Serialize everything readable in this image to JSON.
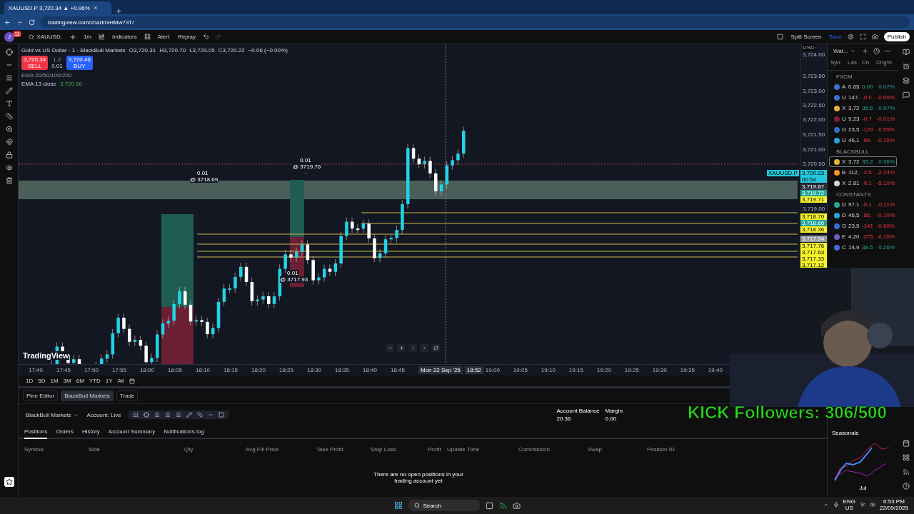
{
  "browser": {
    "tab_title": "XAUUSD.P 3,720.34 ▲ +0.96%",
    "url": "tradingview.com/chart/rxHMw73T/"
  },
  "toolbar": {
    "avatar": "J",
    "badge": "11",
    "symbol": "XAUUSD.",
    "interval": "1m",
    "indicators": "Indicators",
    "alert": "Alert",
    "replay": "Replay",
    "split_screen": "Split Screen",
    "save": "Save",
    "publish": "Publish"
  },
  "legend": {
    "title": "Gold vs US Dollar · 1 · BlackBull Markets",
    "ohlc": [
      {
        "key": "O",
        "value": "3,720.31"
      },
      {
        "key": "H",
        "value": "3,720.70"
      },
      {
        "key": "L",
        "value": "3,720.05"
      },
      {
        "key": "C",
        "value": "3,720.22"
      }
    ],
    "change": "−0.06 (−0.00%)",
    "sell_price": "3,720.34",
    "sell": "SELL",
    "spread": "1.2",
    "qty": "0.01",
    "buy_price": "3,720.46",
    "buy": "BUY",
    "ema_group": "EMA 20/50/100/200",
    "ema_label": "EMA 13 close",
    "ema_value": "3,720.50"
  },
  "trade_marks": [
    {
      "qty": "0.01",
      "price": "@ 3718.69",
      "buy": false
    },
    {
      "qty": "0.01",
      "price": "@ 3719.76",
      "buy": false
    },
    {
      "qty": "0.01",
      "price": "@ 3717.93",
      "buy": true
    }
  ],
  "price_axis": {
    "currency": "USD",
    "ticks": [
      "3,724.00",
      "3,723.50",
      "3,723.00",
      "3,722.50",
      "3,722.00",
      "3,721.50",
      "3,721.00",
      "3,720.50",
      "3,719.00"
    ],
    "tags": [
      {
        "text": "3,720.23",
        "sub": "00:54",
        "color": "#26c6da"
      },
      {
        "text": "3,719.87",
        "color": "#2a2e39"
      },
      {
        "text": "3,719.72",
        "color": "#26a69a"
      },
      {
        "text": "3,719.71",
        "color": "#f5f12b"
      },
      {
        "text": "3,718.70",
        "color": "#f5f12b"
      },
      {
        "text": "3,718.66",
        "color": "#26a69a"
      },
      {
        "text": "3,718.36",
        "color": "#f5f12b"
      },
      {
        "text": "3,717.94",
        "color": "#9598a1"
      },
      {
        "text": "3,717.76",
        "color": "#f5f12b"
      },
      {
        "text": "3,717.63",
        "color": "#f5f12b"
      },
      {
        "text": "3,717.33",
        "color": "#f5f12b"
      },
      {
        "text": "3,717.12",
        "color": "#f5f12b"
      }
    ],
    "symbol_tag": "XAUUSD.P"
  },
  "time_axis": {
    "ticks": [
      "17:40",
      "17:45",
      "17:50",
      "17:55",
      "18:00",
      "18:05",
      "18:10",
      "18:15",
      "18:20",
      "18:25",
      "18:30",
      "18:35",
      "18:40",
      "18:45"
    ],
    "cursor_date": "Mon 22 Sep '25",
    "cursor_time": "18:52",
    "ticks_after": [
      "19:00",
      "19:05",
      "19:10",
      "19:15",
      "19:20",
      "19:25",
      "19:30",
      "19:35",
      "19:40"
    ]
  },
  "logo": "TradingView",
  "ranges": [
    "1D",
    "5D",
    "1M",
    "3M",
    "6M",
    "YTD",
    "1Y",
    "All"
  ],
  "panel_tabs": [
    {
      "label": "Pine Editor",
      "selected": false
    },
    {
      "label": "BlackBull Markets",
      "selected": true
    },
    {
      "label": "Trade",
      "selected": false
    }
  ],
  "broker": {
    "name": "BlackBull Markets",
    "account": "Account: Live"
  },
  "account_stats": [
    {
      "label": "Account Balance",
      "value": "20.36"
    },
    {
      "label": "Margin",
      "value": "0.00"
    }
  ],
  "position_tabs": [
    {
      "label": "Positions",
      "selected": true
    },
    {
      "label": "Orders",
      "selected": false
    },
    {
      "label": "History",
      "selected": false
    },
    {
      "label": "Account Summary",
      "selected": false
    },
    {
      "label": "Notifications log",
      "selected": false
    }
  ],
  "columns": [
    "Symbol",
    "Side",
    "Qty",
    "Avg Fill Price",
    "Take Profit",
    "Stop Loss",
    "Profit",
    "Update Time",
    "Commission",
    "Swap",
    "Position ID"
  ],
  "empty_message": "There are no open positions in your trading account yet",
  "watchlist": {
    "title": "Wat...",
    "columns": [
      "Syn",
      "Las",
      "Ch",
      "Chg%"
    ],
    "sections": [
      {
        "name": "FXCM",
        "rows": [
          {
            "letter": "A",
            "last": "0.65",
            "change": "0.00",
            "percent": "0.07%",
            "positive": true,
            "color": "#3d6fd6",
            "selected": false
          },
          {
            "letter": "U",
            "last": "147.",
            "change": "-0.0",
            "percent": "-0.05%",
            "positive": false,
            "color": "#3d6fd6",
            "selected": false
          },
          {
            "letter": "X",
            "last": "3,72",
            "change": "35.5",
            "percent": "0.97%",
            "positive": true,
            "color": "#e3b53b",
            "selected": false
          },
          {
            "letter": "U",
            "last": "9,23",
            "change": "-0.7",
            "percent": "-0.01%",
            "positive": false,
            "color": "#7a1d3a",
            "selected": false
          },
          {
            "letter": "G",
            "last": "23,5",
            "change": "-129",
            "percent": "-0.55%",
            "positive": false,
            "color": "#2f6fd1",
            "selected": false
          },
          {
            "letter": "U",
            "last": "46,1",
            "change": "-69.",
            "percent": "-0.15%",
            "positive": false,
            "color": "#26a5d8",
            "selected": false
          }
        ]
      },
      {
        "name": "BLACKBULL",
        "rows": [
          {
            "letter": "X",
            "last": "3,72",
            "change": "35.2",
            "percent": "0.96%",
            "positive": true,
            "color": "#e3b53b",
            "selected": true
          },
          {
            "letter": "B",
            "last": "112,",
            "change": "-2.5",
            "percent": "-2.24%",
            "positive": false,
            "color": "#f7931a",
            "selected": false
          },
          {
            "letter": "X",
            "last": "2.81",
            "change": "-0.1",
            "percent": "-5.19%",
            "positive": false,
            "color": "#d1d4dc",
            "selected": false
          }
        ]
      },
      {
        "name": "CONSTANTS",
        "rows": [
          {
            "letter": "D",
            "last": "97.1",
            "change": "-0.1",
            "percent": "-0.11%",
            "positive": false,
            "color": "#26a69a",
            "selected": false
          },
          {
            "letter": "D",
            "last": "46,5",
            "change": "-86.",
            "percent": "-0.19%",
            "positive": false,
            "color": "#26a5d8",
            "selected": false
          },
          {
            "letter": "G",
            "last": "23,5",
            "change": "-141",
            "percent": "-0.60%",
            "positive": false,
            "color": "#2f6fd1",
            "selected": false
          },
          {
            "letter": "E",
            "last": "4,20",
            "change": "-275",
            "percent": "-6.15%",
            "positive": false,
            "color": "#6c5fc7",
            "selected": false
          },
          {
            "letter": "C",
            "last": "14,9",
            "change": "38.5",
            "percent": "0.26%",
            "positive": true,
            "color": "#3d6fd6",
            "selected": false
          }
        ]
      }
    ]
  },
  "seasonals": {
    "title": "Seasonals",
    "month": "Jul"
  },
  "overlay": {
    "text": "KICK Followers: 306/500"
  },
  "webcam": {
    "kind": "picture"
  },
  "taskbar": {
    "search": "Search",
    "lang": "ENG",
    "region": "US",
    "time": "6:53 PM",
    "date": "22/09/2025"
  }
}
